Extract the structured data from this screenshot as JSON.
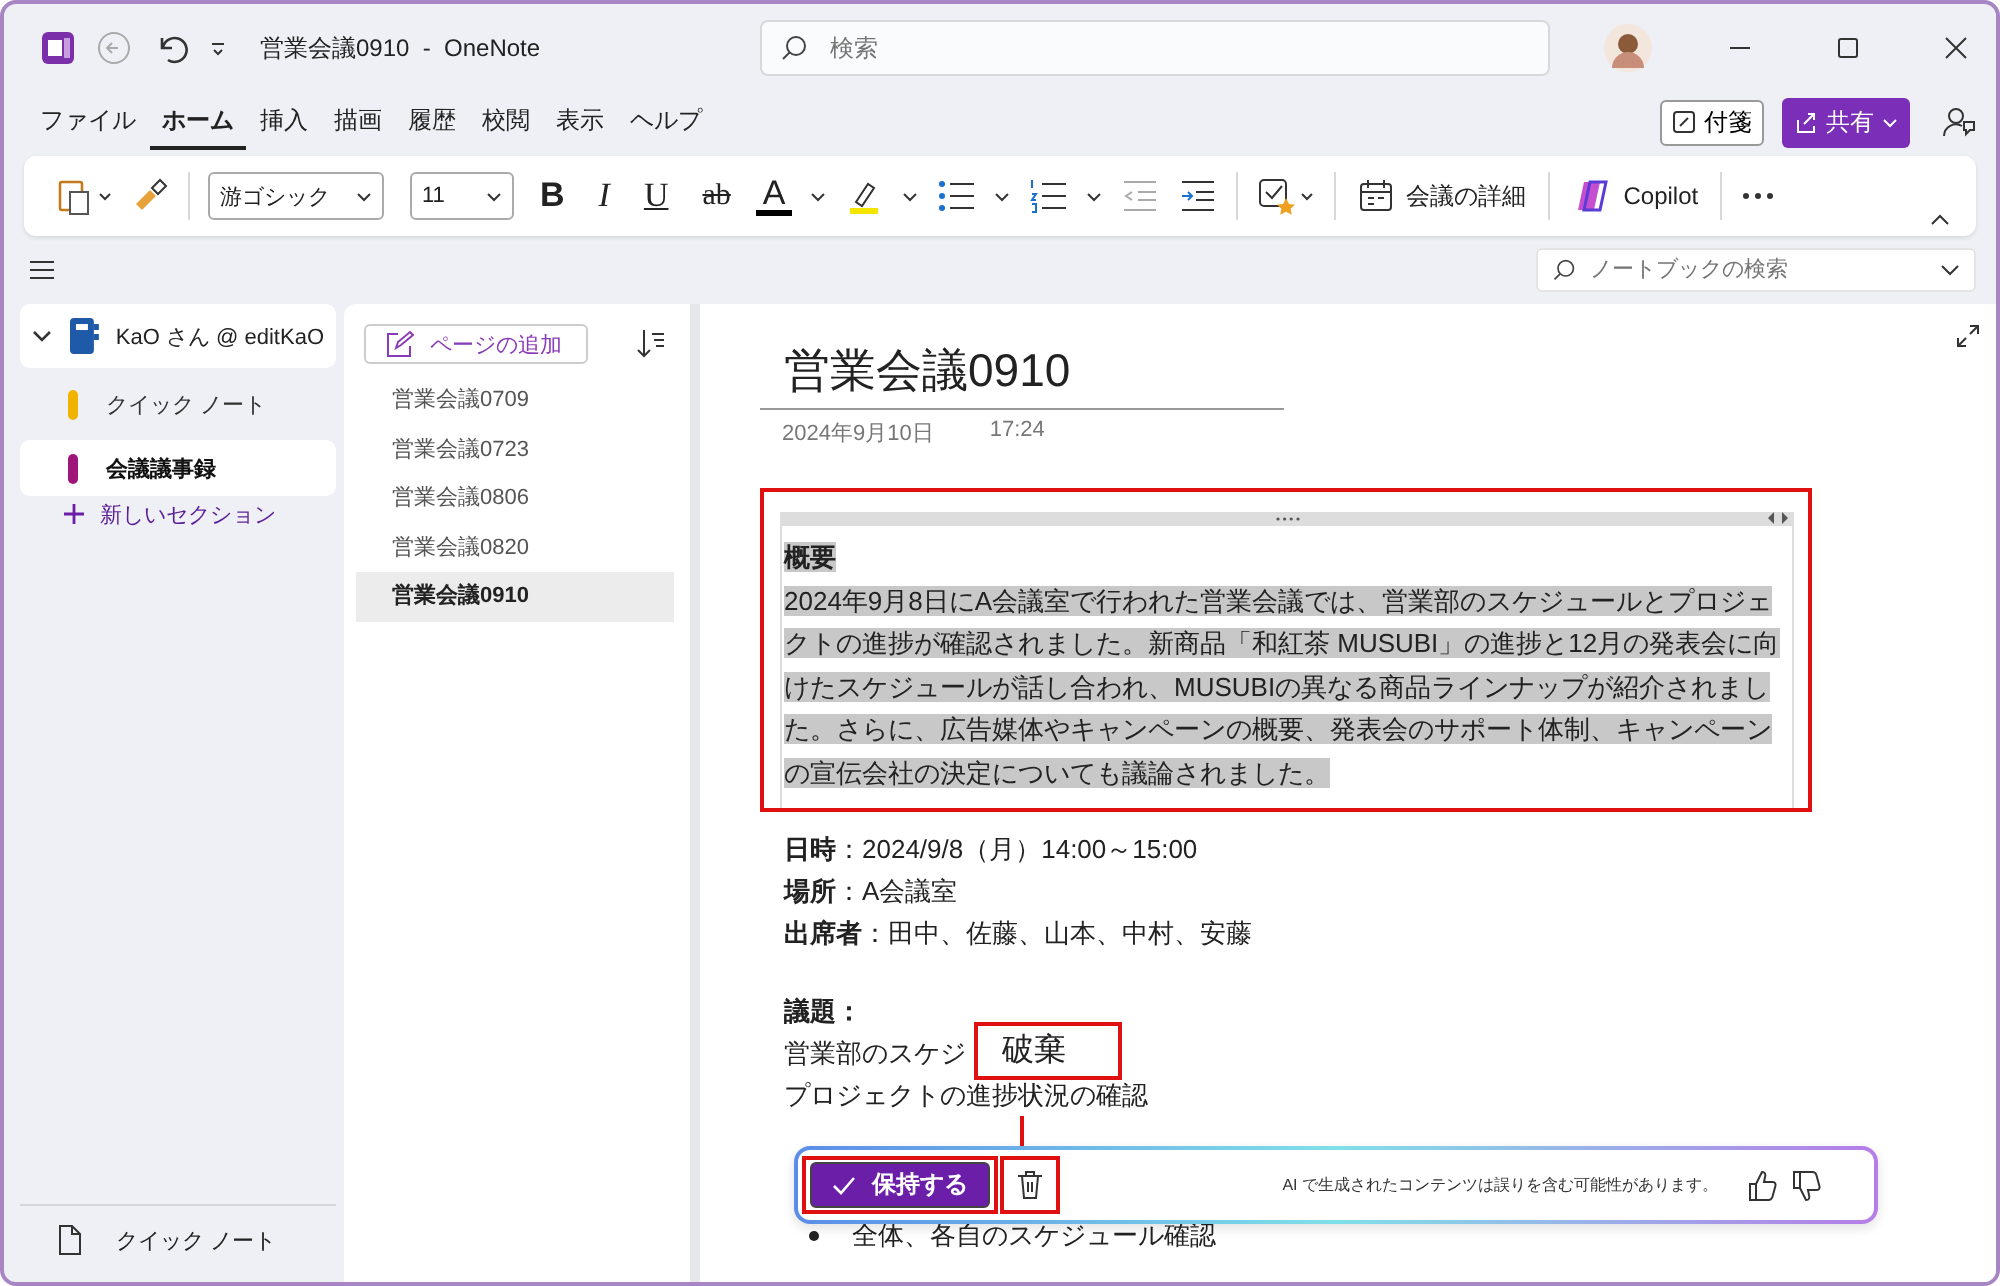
{
  "window": {
    "title": "営業会議0910  -  OneNote"
  },
  "search": {
    "placeholder": "検索"
  },
  "menu_tabs": [
    {
      "label": "ファイル",
      "selected": false
    },
    {
      "label": "ホーム",
      "selected": true
    },
    {
      "label": "挿入",
      "selected": false
    },
    {
      "label": "描画",
      "selected": false
    },
    {
      "label": "履歴",
      "selected": false
    },
    {
      "label": "校閲",
      "selected": false
    },
    {
      "label": "表示",
      "selected": false
    },
    {
      "label": "ヘルプ",
      "selected": false
    }
  ],
  "header_buttons": {
    "sticky_notes": "付箋",
    "share": "共有"
  },
  "ribbon": {
    "font": "游ゴシック",
    "size": "11",
    "bold": "B",
    "italic": "I",
    "underline": "U",
    "strike": "ab",
    "font_color": "A",
    "meeting_details": "会議の詳細",
    "copilot": "Copilot"
  },
  "notebook_search": {
    "placeholder": "ノートブックの検索"
  },
  "notebook": {
    "name": "KaO さん @ editKaO",
    "expanded": true
  },
  "sections": [
    {
      "label": "クイック ノート",
      "color": "#f0b400",
      "selected": false
    },
    {
      "label": "会議議事録",
      "color": "#a0157a",
      "selected": true
    }
  ],
  "new_section": "新しいセクション",
  "footer": "クイック ノート",
  "add_page": "ページの追加",
  "pages": [
    {
      "label": "営業会議0709",
      "selected": false
    },
    {
      "label": "営業会議0723",
      "selected": false
    },
    {
      "label": "営業会議0806",
      "selected": false
    },
    {
      "label": "営業会議0820",
      "selected": false
    },
    {
      "label": "営業会議0910",
      "selected": true
    }
  ],
  "page": {
    "title": "営業会議0910",
    "date": "2024年9月10日",
    "time": "17:24",
    "summary": {
      "heading": "概要",
      "body": "2024年9月8日にA会議室で行われた営業会議では、営業部のスケジュールとプロジェクトの進捗が確認されました。新商品「和紅茶 MUSUBI」の進捗と12月の発表会に向けたスケジュールが話し合われ、MUSUBIの異なる商品ラインナップが紹介されました。さらに、広告媒体やキャンペーンの概要、発表会のサポート体制、キャンペーンの宣伝会社の決定についても議論されました。",
      "highlighted": true
    },
    "details": [
      "**日時**：2024/9/8（月）14:00～15:00",
      "**場所**：A会議室",
      "**出席者**：田中、佐藤、山本、中村、安藤"
    ],
    "agenda_heading": "議題：",
    "agenda": [
      "営業部のスケジ",
      "プロジェクトの進捗状況の確認"
    ],
    "bullets": [
      "全体、各自のスケジュール確認"
    ]
  },
  "ai_bar": {
    "keep": "保持する",
    "disclaimer": "AI で生成されたコンテンツは誤りを含む可能性があります。"
  },
  "callout": "破棄"
}
